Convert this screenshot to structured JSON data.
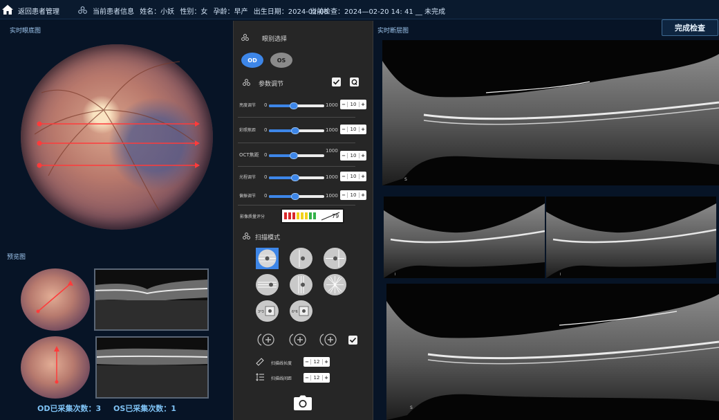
{
  "topbar": {
    "back_label": "返回患者管理",
    "patient_title": "当前患者信息",
    "name": "姓名：小妖",
    "gender": "性别：女",
    "gestation": "孕龄：早产",
    "birth": "出生日期：2024-02-08",
    "exam": "当前检查：2024—02-20 14: 41 __ 未完成"
  },
  "left": {
    "live_fundus_title": "实时眼底图",
    "preview_title": "预览图",
    "od_count": "OD已采集次数：3",
    "os_count": "OS已采集次数：1"
  },
  "middle": {
    "eye_select_title": "眼别选择",
    "od_label": "OD",
    "os_label": "OS",
    "params_title": "参数调节",
    "sliders": [
      {
        "label": "亮度调节",
        "min": "0",
        "max": "1000",
        "value": "10",
        "level": 0.45
      },
      {
        "label": "彩照焦距",
        "min": "0",
        "max": "1000",
        "value": "10",
        "level": 0.47
      },
      {
        "label": "OCT焦距",
        "min": "0",
        "max": "1000",
        "value": "10",
        "level": 0.45
      },
      {
        "label": "光程调节",
        "min": "0",
        "max": "1000",
        "value": "10",
        "level": 0.47
      },
      {
        "label": "偏振调节",
        "min": "0",
        "max": "1000",
        "value": "10",
        "level": 0.47
      }
    ],
    "quality_label": "影像质量评分",
    "quality_value": "79",
    "scan_mode_title": "扫描模式",
    "scan_len_label": "扫描线长度",
    "scan_len_value": "12",
    "scan_gap_label": "扫描线间距",
    "scan_gap_value": "12"
  },
  "right": {
    "live_oct_title": "实时断层图",
    "complete_label": "完成检查",
    "oct_main_marker": "S",
    "oct_left_marker": "I",
    "oct_right_marker": "I",
    "oct_bottom_marker": "S"
  },
  "colors": {
    "accent": "#3d86e8",
    "scan_line": "#ff3b3b",
    "background": "#071426"
  }
}
